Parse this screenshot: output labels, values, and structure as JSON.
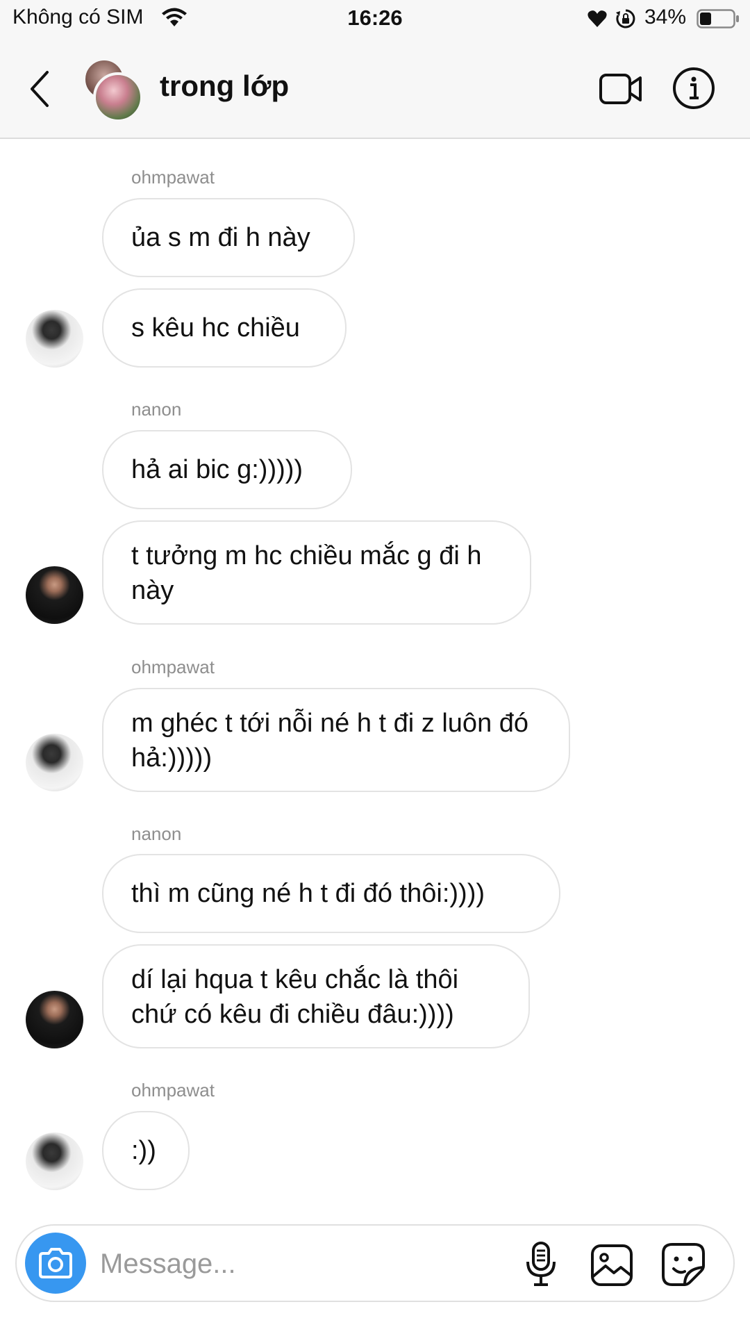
{
  "status_bar": {
    "carrier": "Không có SIM",
    "time": "16:26",
    "battery_percent": "34%",
    "battery_level": 0.34
  },
  "header": {
    "title": "trong lớp",
    "icons": [
      "back-icon",
      "video-call-icon",
      "info-icon"
    ]
  },
  "messages": [
    {
      "sender": "ohmpawat",
      "bubbles": [
        "ủa s m đi h này",
        "s kêu hc chiều"
      ]
    },
    {
      "sender": "nanon",
      "bubbles": [
        "hả ai bic g:)))))",
        "t tưởng m hc chiều mắc g đi h này"
      ]
    },
    {
      "sender": "ohmpawat",
      "bubbles": [
        "m ghéc t tới nỗi né h t đi z luôn đó hả:)))))"
      ]
    },
    {
      "sender": "nanon",
      "bubbles": [
        "thì m cũng né h t đi đó thôi:))))",
        "dí lại hqua t kêu chắc là thôi chứ có kêu đi chiều đâu:))))"
      ]
    },
    {
      "sender": "ohmpawat",
      "bubbles": [
        ":))"
      ]
    }
  ],
  "composer": {
    "placeholder": "Message...",
    "value": ""
  },
  "colors": {
    "accent": "#3797f0",
    "bubble_border": "#e3e3e3",
    "sender_name": "#8e8e8e"
  }
}
